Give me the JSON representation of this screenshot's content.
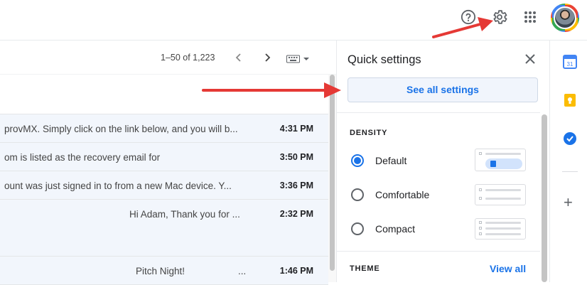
{
  "header": {
    "icons": [
      "help-icon",
      "gear-icon",
      "apps-grid-icon"
    ],
    "avatar_icon": "user-avatar"
  },
  "mail": {
    "pager_count": "1–50 of 1,223",
    "prev_icon": "chevron-left-icon",
    "next_icon": "chevron-right-icon",
    "input_tools_icon": "keyboard-icon",
    "rows": [
      {
        "snippet": "",
        "time": ""
      },
      {
        "snippet": "provMX. Simply click on the link below, and you will b...",
        "time": "4:31 PM"
      },
      {
        "snippet": "om is listed as the recovery email for",
        "time": "3:50 PM"
      },
      {
        "snippet": "ount was just signed in to from a new Mac device. Y...",
        "time": "3:36 PM"
      },
      {
        "snippet": "Hi Adam, Thank you for ...",
        "time": "2:32 PM"
      },
      {
        "snippet": "Pitch Night!",
        "dots": "...",
        "time": "1:46 PM"
      }
    ]
  },
  "quick_settings": {
    "title": "Quick settings",
    "close_icon": "close-icon",
    "see_all_label": "See all settings",
    "density_label": "DENSITY",
    "density_options": [
      {
        "label": "Default",
        "selected": true
      },
      {
        "label": "Comfortable",
        "selected": false
      },
      {
        "label": "Compact",
        "selected": false
      }
    ],
    "theme_label": "THEME",
    "view_all_label": "View all"
  },
  "side_panel": {
    "apps": [
      "calendar-icon",
      "keep-icon",
      "tasks-icon"
    ],
    "calendar_day": "31",
    "add_icon": "plus-icon",
    "add_label": "+"
  },
  "annotations": {
    "arrow_color": "#e53935",
    "accent": "#1a73e8"
  }
}
